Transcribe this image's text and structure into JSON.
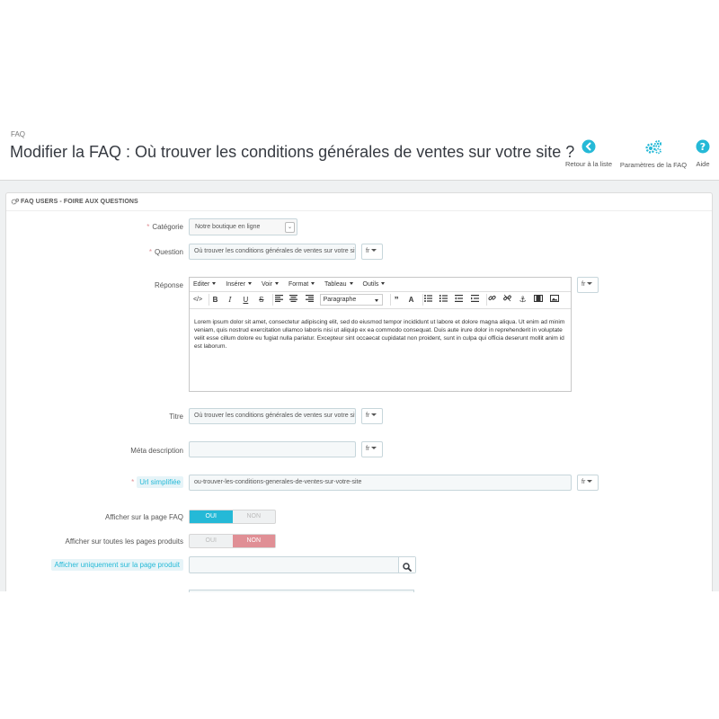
{
  "header": {
    "breadcrumb": "FAQ",
    "title": "Modifier la FAQ : Où trouver les conditions générales de ventes sur votre site ?",
    "toolbar": [
      {
        "label": "Retour à la liste",
        "icon": "back-arrow-circle-icon"
      },
      {
        "label": "Paramètres de la FAQ",
        "icon": "gears-icon"
      },
      {
        "label": "Aide",
        "icon": "help-circle-icon"
      }
    ]
  },
  "panel": {
    "heading": "FAQ USERS - FOIRE AUX QUESTIONS",
    "icon": "cogs-icon"
  },
  "form": {
    "categorie": {
      "label": "Catégorie",
      "value": "Notre boutique en ligne"
    },
    "question": {
      "label": "Question",
      "value": "Où trouver les conditions générales de ventes sur votre site ?",
      "lang": "fr"
    },
    "reponse": {
      "label": "Réponse",
      "lang": "fr",
      "menu": [
        "Editer",
        "Insérer",
        "Voir",
        "Format",
        "Tableau",
        "Outils"
      ],
      "paragraph": "Paragraphe",
      "content": "Lorem ipsum dolor sit amet, consectetur adipiscing elit, sed do eiusmod tempor incididunt ut labore et dolore magna aliqua. Ut enim ad minim veniam, quis nostrud exercitation ullamco laboris nisi ut aliquip ex ea commodo consequat. Duis aute irure dolor in reprehenderit in voluptate velit esse cillum dolore eu fugiat nulla pariatur. Excepteur sint occaecat cupidatat non proident, sunt in culpa qui officia deserunt mollit anim id est laborum."
    },
    "titre": {
      "label": "Titre",
      "value": "Où trouver les conditions générales de ventes sur votre site ?",
      "lang": "fr"
    },
    "meta": {
      "label": "Méta description",
      "value": "",
      "lang": "fr"
    },
    "url": {
      "label": "Url simplifiée",
      "value": "ou-trouver-les-conditions-generales-de-ventes-sur-votre-site",
      "lang": "fr"
    },
    "faq_page": {
      "label": "Afficher sur la page FAQ",
      "yes": "OUI",
      "no": "NON",
      "selected": "OUI"
    },
    "all_products": {
      "label": "Afficher sur toutes les pages produits",
      "yes": "OUI",
      "no": "NON",
      "selected": "NON"
    },
    "only_product": {
      "label": "Afficher uniquement sur la page produit",
      "value": ""
    }
  },
  "colors": {
    "accent": "#25b9d7",
    "danger": "#e08f95",
    "title": "#363a41"
  }
}
